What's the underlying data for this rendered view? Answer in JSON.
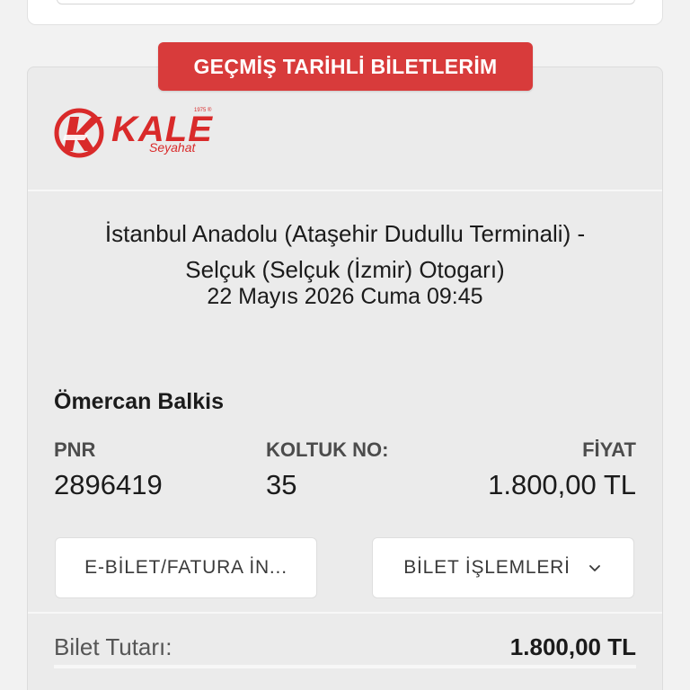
{
  "section_tab": {
    "label": "GEÇMİŞ TARİHLİ BİLETLERİM"
  },
  "logo": {
    "brand": "KALE",
    "sub": "Seyahat",
    "mark": "1975 ®"
  },
  "trip": {
    "route_line1": "İstanbul Anadolu (Ataşehir Dudullu Terminali) -",
    "route_line2": "Selçuk (Selçuk (İzmir) Otogarı)",
    "date": "22 Mayıs 2026 Cuma 09:45"
  },
  "passenger": {
    "name": "Ömercan Balkis"
  },
  "details": {
    "pnr_label": "PNR",
    "pnr_value": "2896419",
    "seat_label": "KOLTUK NO:",
    "seat_value": "35",
    "price_label": "FİYAT",
    "price_value": "1.800,00 TL"
  },
  "actions": {
    "ebilet_label": "E-BİLET/FATURA İN...",
    "islemler_label": "BİLET İŞLEMLERİ",
    "islemler_icon": "chevron-down-icon"
  },
  "summary": {
    "total_label": "Bilet Tutarı:",
    "total_value": "1.800,00 TL"
  },
  "colors": {
    "accent": "#d83b3b",
    "brand": "#d92a2a",
    "card_bg": "#ebebeb"
  }
}
